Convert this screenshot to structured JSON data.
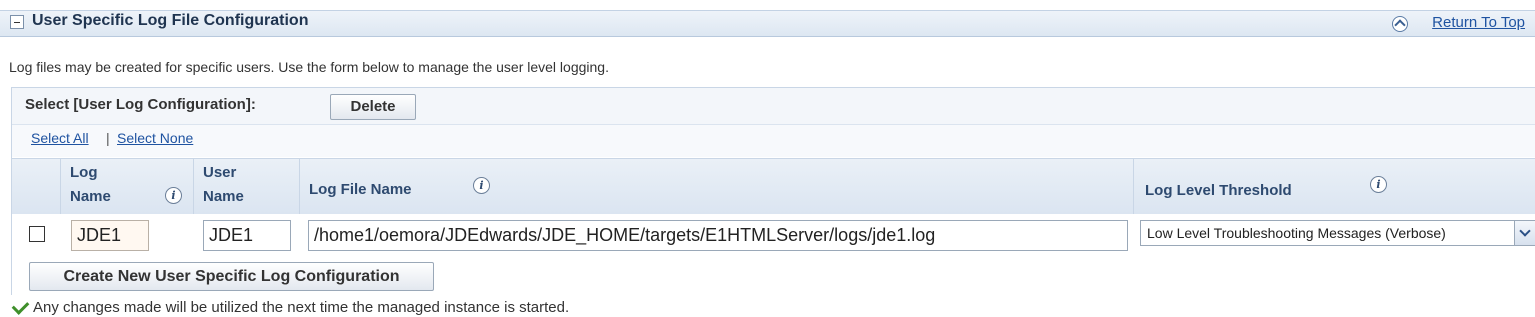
{
  "section": {
    "title": "User Specific Log File Configuration",
    "return_to_top": "Return To Top"
  },
  "description": "Log files may be created for specific users. Use the form below to manage the user level logging.",
  "select_bar": {
    "label": "Select [User Log Configuration]:",
    "delete_label": "Delete"
  },
  "links": {
    "select_all": "Select All",
    "separator": "|",
    "select_none": "Select None"
  },
  "table": {
    "columns": {
      "log_name_1": "Log",
      "log_name_2": "Name",
      "user_name_1": "User",
      "user_name_2": "Name",
      "log_file_name": "Log File Name",
      "log_level_threshold": "Log Level Threshold"
    },
    "info_icon_glyph": "i",
    "rows": [
      {
        "selected": false,
        "log_name": "JDE1",
        "user_name": "JDE1",
        "log_file_name": "/home1/oemora/JDEdwards/JDE_HOME/targets/E1HTMLServer/logs/jde1.log",
        "log_level_threshold": "Low Level Troubleshooting Messages (Verbose)"
      }
    ]
  },
  "create_button_label": "Create New User Specific Log Configuration",
  "note": "Any changes made will be utilized the next time the managed instance is started.",
  "colors": {
    "link": "#1f53a1",
    "header_bg": "#dde7f2",
    "success_check": "#3f8f2b"
  },
  "icons": {
    "collapse": "collapse-icon",
    "return_top": "up-arrow-icon",
    "info": "info-icon",
    "dropdown": "chevron-down-icon",
    "success": "checkmark-icon"
  }
}
